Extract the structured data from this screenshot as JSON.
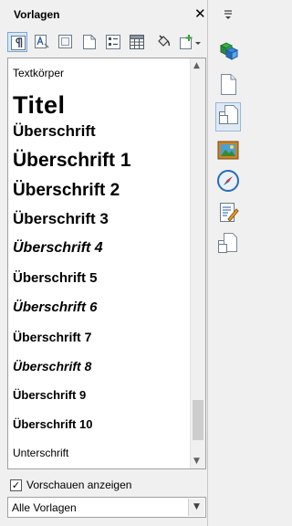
{
  "panel": {
    "title": "Vorlagen",
    "close_icon": "close-icon"
  },
  "toolbar": {
    "buttons": [
      {
        "name": "paragraph-styles",
        "icon": "paragraph-icon",
        "active": true
      },
      {
        "name": "character-styles",
        "icon": "character-icon",
        "active": false
      },
      {
        "name": "frame-styles",
        "icon": "frame-icon",
        "active": false
      },
      {
        "name": "page-styles",
        "icon": "page-icon",
        "active": false
      },
      {
        "name": "list-styles",
        "icon": "list-icon",
        "active": false
      },
      {
        "name": "table-styles",
        "icon": "table-icon",
        "active": false
      },
      {
        "name": "fill-format-mode",
        "icon": "paint-bucket-icon",
        "active": false
      },
      {
        "name": "new-style",
        "icon": "new-style-icon",
        "active": false
      }
    ]
  },
  "styles": [
    {
      "label": "Textkörper"
    },
    {
      "label": "Titel"
    },
    {
      "label": "Überschrift"
    },
    {
      "label": "Überschrift 1"
    },
    {
      "label": "Überschrift 2"
    },
    {
      "label": "Überschrift 3"
    },
    {
      "label": "Überschrift 4"
    },
    {
      "label": "Überschrift 5"
    },
    {
      "label": "Überschrift 6"
    },
    {
      "label": "Überschrift 7"
    },
    {
      "label": "Überschrift 8"
    },
    {
      "label": "Überschrift 9"
    },
    {
      "label": "Überschrift 10"
    },
    {
      "label": "Unterschrift"
    }
  ],
  "preview": {
    "label": "Vorschauen anzeigen",
    "checked": true
  },
  "filter": {
    "value": "Alle Vorlagen"
  },
  "sidebar": {
    "menu_icon": "sidebar-menu-icon",
    "items": [
      "properties-icon",
      "page-icon",
      "styles-icon",
      "gallery-icon",
      "navigator-icon",
      "manage-changes-icon",
      "design-icon"
    ]
  },
  "colors": {
    "active_bg": "#d8e8f8",
    "active_border": "#7aa6d6"
  }
}
